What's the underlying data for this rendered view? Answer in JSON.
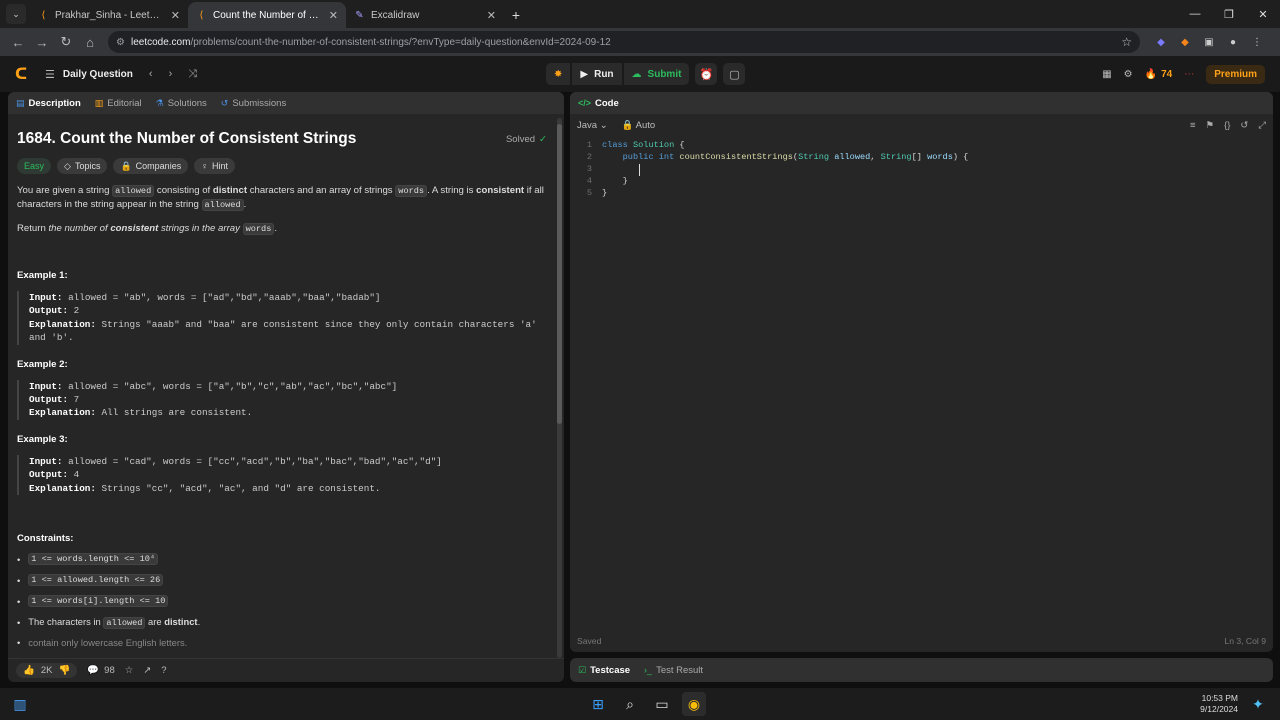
{
  "browser": {
    "tabs": [
      {
        "title": "Prakhar_Sinha - LeetCode Profile",
        "icon": "leetcode-icon",
        "active": false
      },
      {
        "title": "Count the Number of Consistent",
        "icon": "leetcode-icon",
        "active": true
      },
      {
        "title": "Excalidraw",
        "icon": "excalidraw-icon",
        "active": false
      }
    ],
    "url_host": "leetcode.com",
    "url_path": "/problems/count-the-number-of-consistent-strings/?envType=daily-question&envId=2024-09-12"
  },
  "header": {
    "daily_label": "Daily Question",
    "run_label": "Run",
    "submit_label": "Submit",
    "streak": "74",
    "premium_label": "Premium"
  },
  "desc_tabs": [
    "Description",
    "Editorial",
    "Solutions",
    "Submissions"
  ],
  "problem": {
    "title": "1684. Count the Number of Consistent Strings",
    "status": "Solved",
    "tags": [
      "Easy",
      "Topics",
      "Companies",
      "Hint"
    ],
    "p1": {
      "a": "You are given a string ",
      "c1": "allowed",
      "b": " consisting of ",
      "distinct": "distinct",
      "c": " characters and an array of strings ",
      "c2": "words",
      "d": ". A string is ",
      "consistent": "consistent",
      "e": " if all characters in the string appear in the string ",
      "c3": "allowed",
      "f": "."
    },
    "p2": {
      "a": "Return ",
      "b": "the number of ",
      "c": "consistent",
      "d": " strings in the array ",
      "code": "words",
      "e": "."
    },
    "examples": [
      {
        "head": "Example 1:",
        "input": "allowed = \"ab\", words = [\"ad\",\"bd\",\"aaab\",\"baa\",\"badab\"]",
        "output": "2",
        "explanation": "Strings \"aaab\" and \"baa\" are consistent since they only contain characters 'a' and 'b'."
      },
      {
        "head": "Example 2:",
        "input": "allowed = \"abc\", words = [\"a\",\"b\",\"c\",\"ab\",\"ac\",\"bc\",\"abc\"]",
        "output": "7",
        "explanation": "All strings are consistent."
      },
      {
        "head": "Example 3:",
        "input": "allowed = \"cad\", words = [\"cc\",\"acd\",\"b\",\"ba\",\"bac\",\"bad\",\"ac\",\"d\"]",
        "output": "4",
        "explanation": "Strings \"cc\", \"acd\", \"ac\", and \"d\" are consistent."
      }
    ],
    "labels": {
      "input": "Input:",
      "output": "Output:",
      "explanation": "Explanation:"
    },
    "constraints_head": "Constraints:",
    "constraints": [
      "1 <= words.length <= 10⁴",
      "1 <= allowed.length <= 26",
      "1 <= words[i].length <= 10"
    ],
    "c4": {
      "a": "The characters in ",
      "code": "allowed",
      "b": " are ",
      "strong": "distinct",
      "c": "."
    },
    "c5_cut": "contain only lowercase English letters."
  },
  "desc_footer": {
    "likes": "2K",
    "comments": "98"
  },
  "code_panel": {
    "title": "Code",
    "language": "Java",
    "mode": "Auto",
    "status": "Saved",
    "position": "Ln 3, Col 9",
    "lines": [
      "1",
      "2",
      "3",
      "4",
      "5"
    ]
  },
  "test_tabs": [
    "Testcase",
    "Test Result"
  ],
  "taskbar": {
    "time": "10:53 PM",
    "date": "9/12/2024"
  },
  "colors": {
    "accent": "#ffa116",
    "success": "#2cbb5d"
  }
}
